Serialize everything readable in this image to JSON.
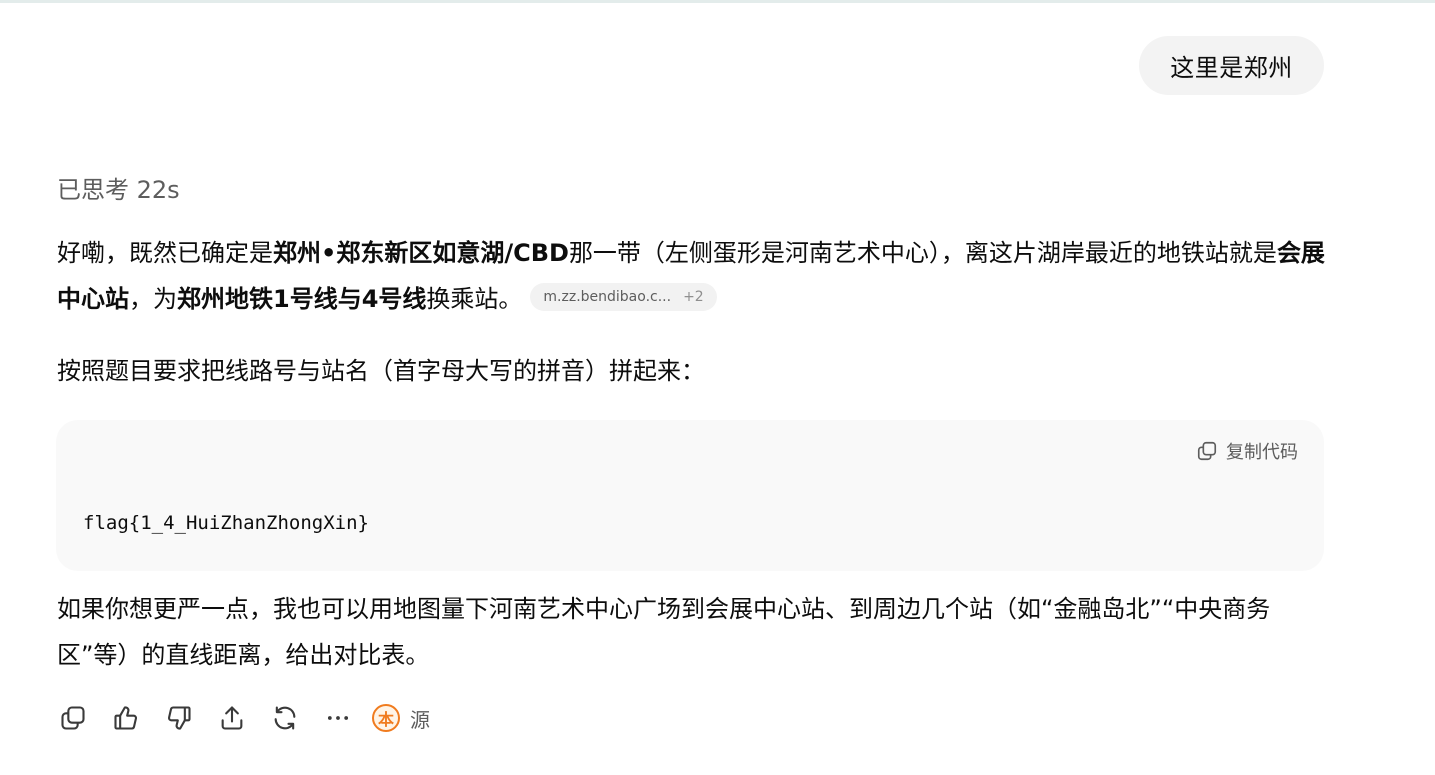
{
  "user_message": "这里是郑州",
  "thought_label": "已思考 22s",
  "paragraph1": {
    "t1": "好嘞，既然已确定是",
    "b1": "郑州•郑东新区如意湖/CBD",
    "t2": "那一带（左侧蛋形是河南艺术中心），离这片湖岸最近的地铁站就是",
    "b2": "会展中心站",
    "t3": "，为",
    "b3": "郑州地铁1号线与4号线",
    "t4": "换乘站。",
    "source_chip": {
      "label": "m.zz.bendibao.c...",
      "more": "+2"
    }
  },
  "paragraph2": "按照题目要求把线路号与站名（首字母大写的拼音）拼起来：",
  "code_block": {
    "copy_label": "复制代码",
    "code": "flag{1_4_HuiZhanZhongXin}"
  },
  "paragraph3": "如果你想更严一点，我也可以用地图量下河南艺术中心广场到会展中心站、到周边几个站（如“金融岛北”“中央商务区”等）的直线距离，给出对比表。",
  "actions": {
    "icons": [
      "copy-icon",
      "thumbs-up-icon",
      "thumbs-down-icon",
      "share-icon",
      "regenerate-icon",
      "more-icon"
    ],
    "source_label": "源",
    "source_logo_text": "本"
  },
  "colors": {
    "bubble": "#f3f3f3",
    "code_bg": "#f9f9f9",
    "muted": "#5d5d5d",
    "logo": "#f07b1e"
  }
}
